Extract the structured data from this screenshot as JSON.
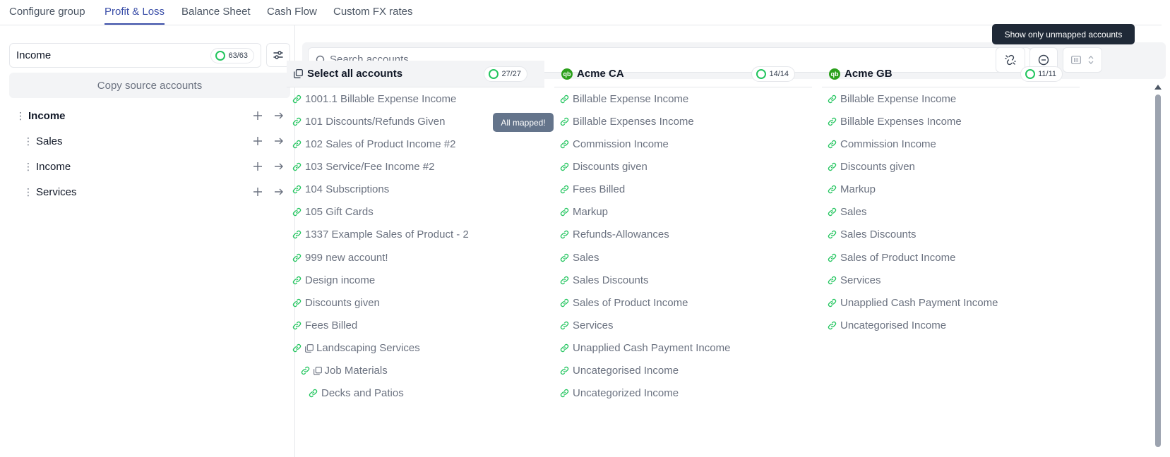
{
  "tabs": [
    {
      "label": "Configure group",
      "active": false
    },
    {
      "label": "Profit & Loss",
      "active": true
    },
    {
      "label": "Balance Sheet",
      "active": false
    },
    {
      "label": "Cash Flow",
      "active": false
    },
    {
      "label": "Custom FX rates",
      "active": false
    }
  ],
  "left": {
    "group_value": "Income",
    "group_count": "63/63",
    "copy_label": "Copy source accounts",
    "tree": [
      {
        "label": "Income",
        "level": 0
      },
      {
        "label": "Sales",
        "level": 1
      },
      {
        "label": "Income",
        "level": 1
      },
      {
        "label": "Services",
        "level": 1
      }
    ]
  },
  "search": {
    "placeholder": "Search accounts"
  },
  "tooltips": {
    "unmapped": "Show only unmapped accounts",
    "all_mapped": "All mapped!"
  },
  "columns": [
    {
      "title": "Select all accounts",
      "count": "27/27",
      "icon": "select-all-icon",
      "accounts": [
        {
          "label": "1001.1 Billable Expense Income",
          "indent": 0,
          "group": false
        },
        {
          "label": "101 Discounts/Refunds Given",
          "indent": 0,
          "group": false
        },
        {
          "label": "102 Sales of Product Income #2",
          "indent": 0,
          "group": false
        },
        {
          "label": "103 Service/Fee Income #2",
          "indent": 0,
          "group": false
        },
        {
          "label": "104 Subscriptions",
          "indent": 0,
          "group": false
        },
        {
          "label": "105 Gift Cards",
          "indent": 0,
          "group": false
        },
        {
          "label": "1337 Example Sales of Product - 2",
          "indent": 0,
          "group": false
        },
        {
          "label": "999 new account!",
          "indent": 0,
          "group": false
        },
        {
          "label": "Design income",
          "indent": 0,
          "group": false
        },
        {
          "label": "Discounts given",
          "indent": 0,
          "group": false
        },
        {
          "label": "Fees Billed",
          "indent": 0,
          "group": false
        },
        {
          "label": "Landscaping Services",
          "indent": 0,
          "group": true
        },
        {
          "label": "Job Materials",
          "indent": 1,
          "group": true
        },
        {
          "label": "Decks and Patios",
          "indent": 2,
          "group": false
        }
      ]
    },
    {
      "title": "Acme CA",
      "count": "14/14",
      "icon": "quickbooks-icon",
      "accounts": [
        {
          "label": "Billable Expense Income"
        },
        {
          "label": "Billable Expenses Income"
        },
        {
          "label": "Commission Income"
        },
        {
          "label": "Discounts given"
        },
        {
          "label": "Fees Billed"
        },
        {
          "label": "Markup"
        },
        {
          "label": "Refunds-Allowances"
        },
        {
          "label": "Sales"
        },
        {
          "label": "Sales Discounts"
        },
        {
          "label": "Sales of Product Income"
        },
        {
          "label": "Services"
        },
        {
          "label": "Unapplied Cash Payment Income"
        },
        {
          "label": "Uncategorised Income"
        },
        {
          "label": "Uncategorized Income"
        }
      ]
    },
    {
      "title": "Acme GB",
      "count": "11/11",
      "icon": "quickbooks-icon",
      "accounts": [
        {
          "label": "Billable Expense Income"
        },
        {
          "label": "Billable Expenses Income"
        },
        {
          "label": "Commission Income"
        },
        {
          "label": "Discounts given"
        },
        {
          "label": "Markup"
        },
        {
          "label": "Sales"
        },
        {
          "label": "Sales Discounts"
        },
        {
          "label": "Sales of Product Income"
        },
        {
          "label": "Services"
        },
        {
          "label": "Unapplied Cash Payment Income"
        },
        {
          "label": "Uncategorised Income"
        }
      ]
    }
  ],
  "colors": {
    "accent": "#3b4fa8",
    "mapped": "#22c55e",
    "link": "#22c55e",
    "qb": "#2ca01c"
  }
}
